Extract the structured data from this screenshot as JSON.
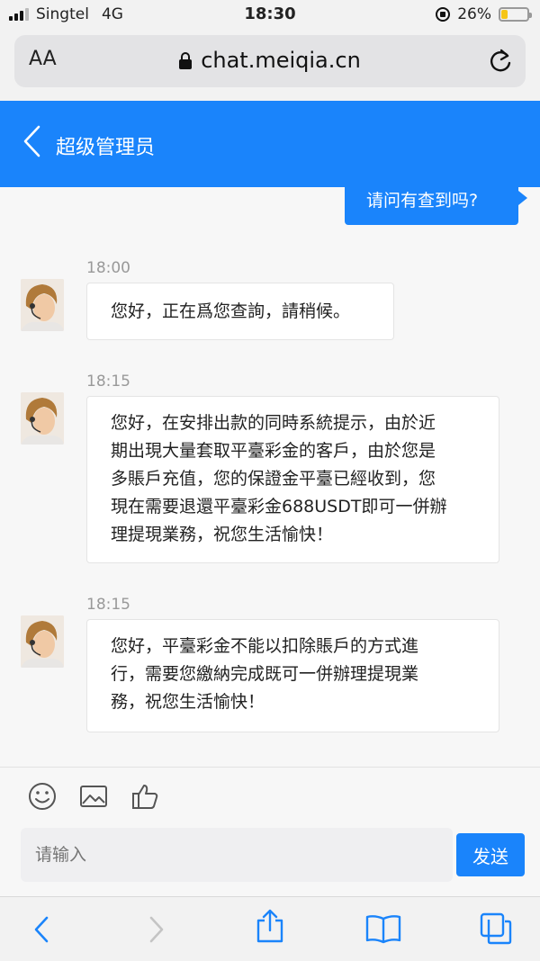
{
  "status_bar": {
    "carrier": "Singtel",
    "network": "4G",
    "time": "18:30",
    "battery_percent": "26%",
    "battery_level": 0.26
  },
  "browser": {
    "text_size_label": "AA",
    "url": "chat.meiqia.cn"
  },
  "chat": {
    "title": "超级管理员",
    "outgoing_message": "请问有查到吗?",
    "messages": [
      {
        "time": "18:00",
        "lines": [
          "您好，正在爲您查詢，請稍候。"
        ]
      },
      {
        "time": "18:15",
        "lines": [
          "您好，在安排出款的同時系統提示，由於近",
          "期出現大量套取平臺彩金的客戶，由於您是",
          "多賬戶充值，您的保證金平臺已經收到，您",
          "現在需要退還平臺彩金688USDT即可一併辦",
          "理提現業務，祝您生活愉快！"
        ]
      },
      {
        "time": "18:15",
        "lines": [
          "您好，平臺彩金不能以扣除賬戶的方式進",
          "行，需要您繳納完成既可一併辦理提現業",
          "務，祝您生活愉快！"
        ]
      }
    ]
  },
  "composer": {
    "placeholder": "请输入",
    "send_label": "发送"
  },
  "colors": {
    "accent": "#1a84fb",
    "safari_icon": "#1a84fb"
  }
}
